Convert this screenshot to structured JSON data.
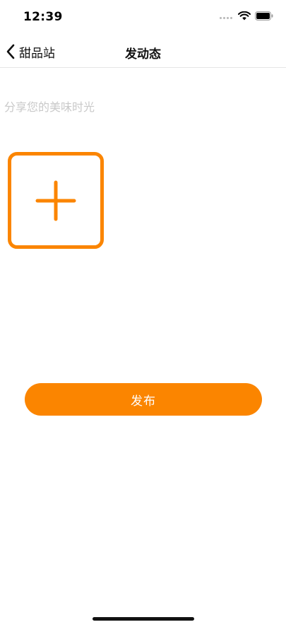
{
  "status_bar": {
    "time": "12:39"
  },
  "nav": {
    "back_label": "甜品站",
    "title": "发动态"
  },
  "composer": {
    "placeholder": "分享您的美味时光",
    "value": ""
  },
  "actions": {
    "publish_label": "发布"
  },
  "colors": {
    "accent": "#fb8500",
    "placeholder": "#c9c9c9",
    "divider": "#e6e6e6"
  },
  "icons": {
    "back": "chevron-left-icon",
    "add": "plus-icon",
    "wifi": "wifi-icon",
    "battery": "battery-icon"
  }
}
